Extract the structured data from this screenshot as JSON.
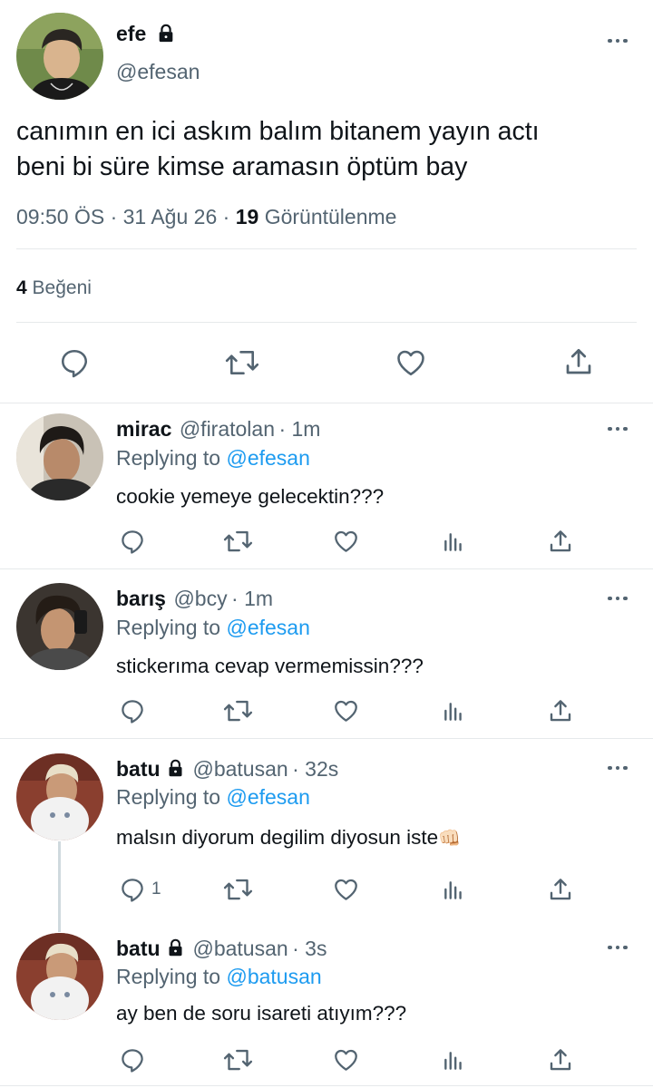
{
  "main_tweet": {
    "name": "efe",
    "handle": "@efesan",
    "text_line1": "canımın en ici askım balım bitanem yayın actı",
    "text_line2": "beni bi süre kimse aramasın öptüm bay",
    "time": "09:50 ÖS",
    "sep": "·",
    "date": "31 Ağu 26",
    "views_count": "19",
    "views_label": "Görüntülenme",
    "likes_count": "4",
    "likes_label": "Beğeni"
  },
  "replies": [
    {
      "name": "mirac",
      "handle": "@firatolan",
      "age": "· 1m",
      "replying_label": "Replying to",
      "replying_to": "@efesan",
      "text": "cookie yemeye gelecektin???",
      "reply_count": ""
    },
    {
      "name": "barış",
      "handle": "@bcy",
      "age": "· 1m",
      "replying_label": "Replying to",
      "replying_to": "@efesan",
      "text": "stickerıma cevap vermemissin???",
      "reply_count": ""
    },
    {
      "name": "batu",
      "handle": "@batusan",
      "age": "· 32s",
      "replying_label": "Replying to",
      "replying_to": "@efesan",
      "text": "malsın diyorum degilim diyosun iste",
      "emoji": "👊🏻",
      "reply_count": "1"
    },
    {
      "name": "batu",
      "handle": "@batusan",
      "age": "· 3s",
      "replying_label": "Replying to",
      "replying_to": "@batusan",
      "text": "ay ben de soru isareti atıyım???",
      "reply_count": ""
    }
  ],
  "colors": {
    "accent": "#1d9bf0",
    "text": "#0f1419",
    "muted": "#536471",
    "divider": "#e6e9eb"
  }
}
